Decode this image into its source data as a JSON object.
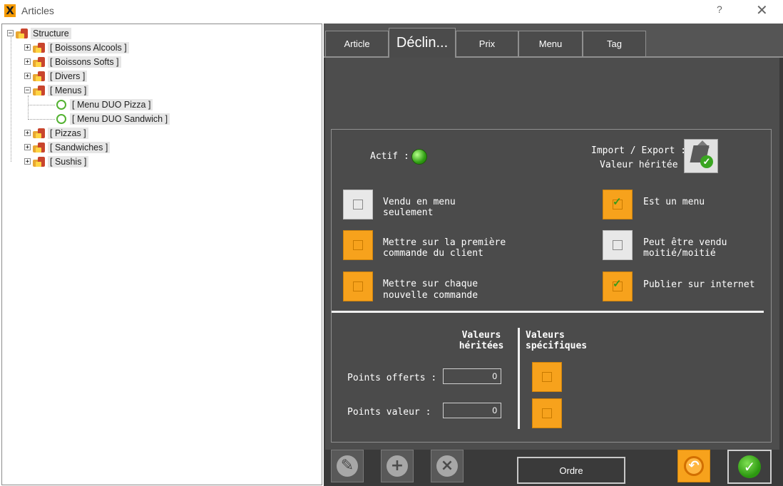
{
  "window": {
    "title": "Articles",
    "help_symbol": "?",
    "close_symbol": "✕"
  },
  "tree": {
    "root": "Structure",
    "items": [
      {
        "label": "[ Boissons Alcools ]",
        "expander": "+"
      },
      {
        "label": "[ Boissons Softs ]",
        "expander": "+"
      },
      {
        "label": "[ Divers ]",
        "expander": "+"
      },
      {
        "label": "[ Menus ]",
        "expander": "−"
      },
      {
        "label": "[ Menu DUO Pizza ]"
      },
      {
        "label": "[ Menu DUO Sandwich ]"
      },
      {
        "label": "[ Pizzas ]",
        "expander": "+"
      },
      {
        "label": "[ Sandwiches ]",
        "expander": "+"
      },
      {
        "label": "[ Sushis ]",
        "expander": "+"
      }
    ],
    "root_expander": "−"
  },
  "tabs": [
    "Article",
    "Déclin...",
    "Prix",
    "Menu",
    "Tag"
  ],
  "active_tab": "Déclin...",
  "form": {
    "actif_label": "Actif :",
    "import_export_label": "Import / Export :",
    "valeur_heritee_label": "Valeur héritée",
    "options": [
      {
        "label_line1": "Vendu en menu",
        "label_line2": "seulement",
        "style": "white",
        "checked": false
      },
      {
        "label_line1": "Est un menu",
        "label_line2": "",
        "style": "orange",
        "checked": true
      },
      {
        "label_line1": "Mettre sur la première",
        "label_line2": "commande du client",
        "style": "orange",
        "checked": false
      },
      {
        "label_line1": "Peut être vendu",
        "label_line2": "moitié/moitié",
        "style": "white",
        "checked": false
      },
      {
        "label_line1": "Mettre sur chaque",
        "label_line2": "nouvelle commande",
        "style": "orange",
        "checked": false
      },
      {
        "label_line1": "Publier sur internet",
        "label_line2": "",
        "style": "orange",
        "checked": true
      }
    ],
    "col_valeurs_heritees_1": "Valeurs",
    "col_valeurs_heritees_2": "héritées",
    "col_valeurs_specifiques_1": "Valeurs",
    "col_valeurs_specifiques_2": "spécifiques",
    "points_offerts_label": "Points offerts :",
    "points_offerts_value": "0",
    "points_valeur_label": "Points valeur :",
    "points_valeur_value": "0"
  },
  "bottom": {
    "ordre_label": "Ordre"
  },
  "colors": {
    "accent_orange": "#f7a21c",
    "panel_dark": "#4b4b4b",
    "ok_green": "#2c9810"
  }
}
